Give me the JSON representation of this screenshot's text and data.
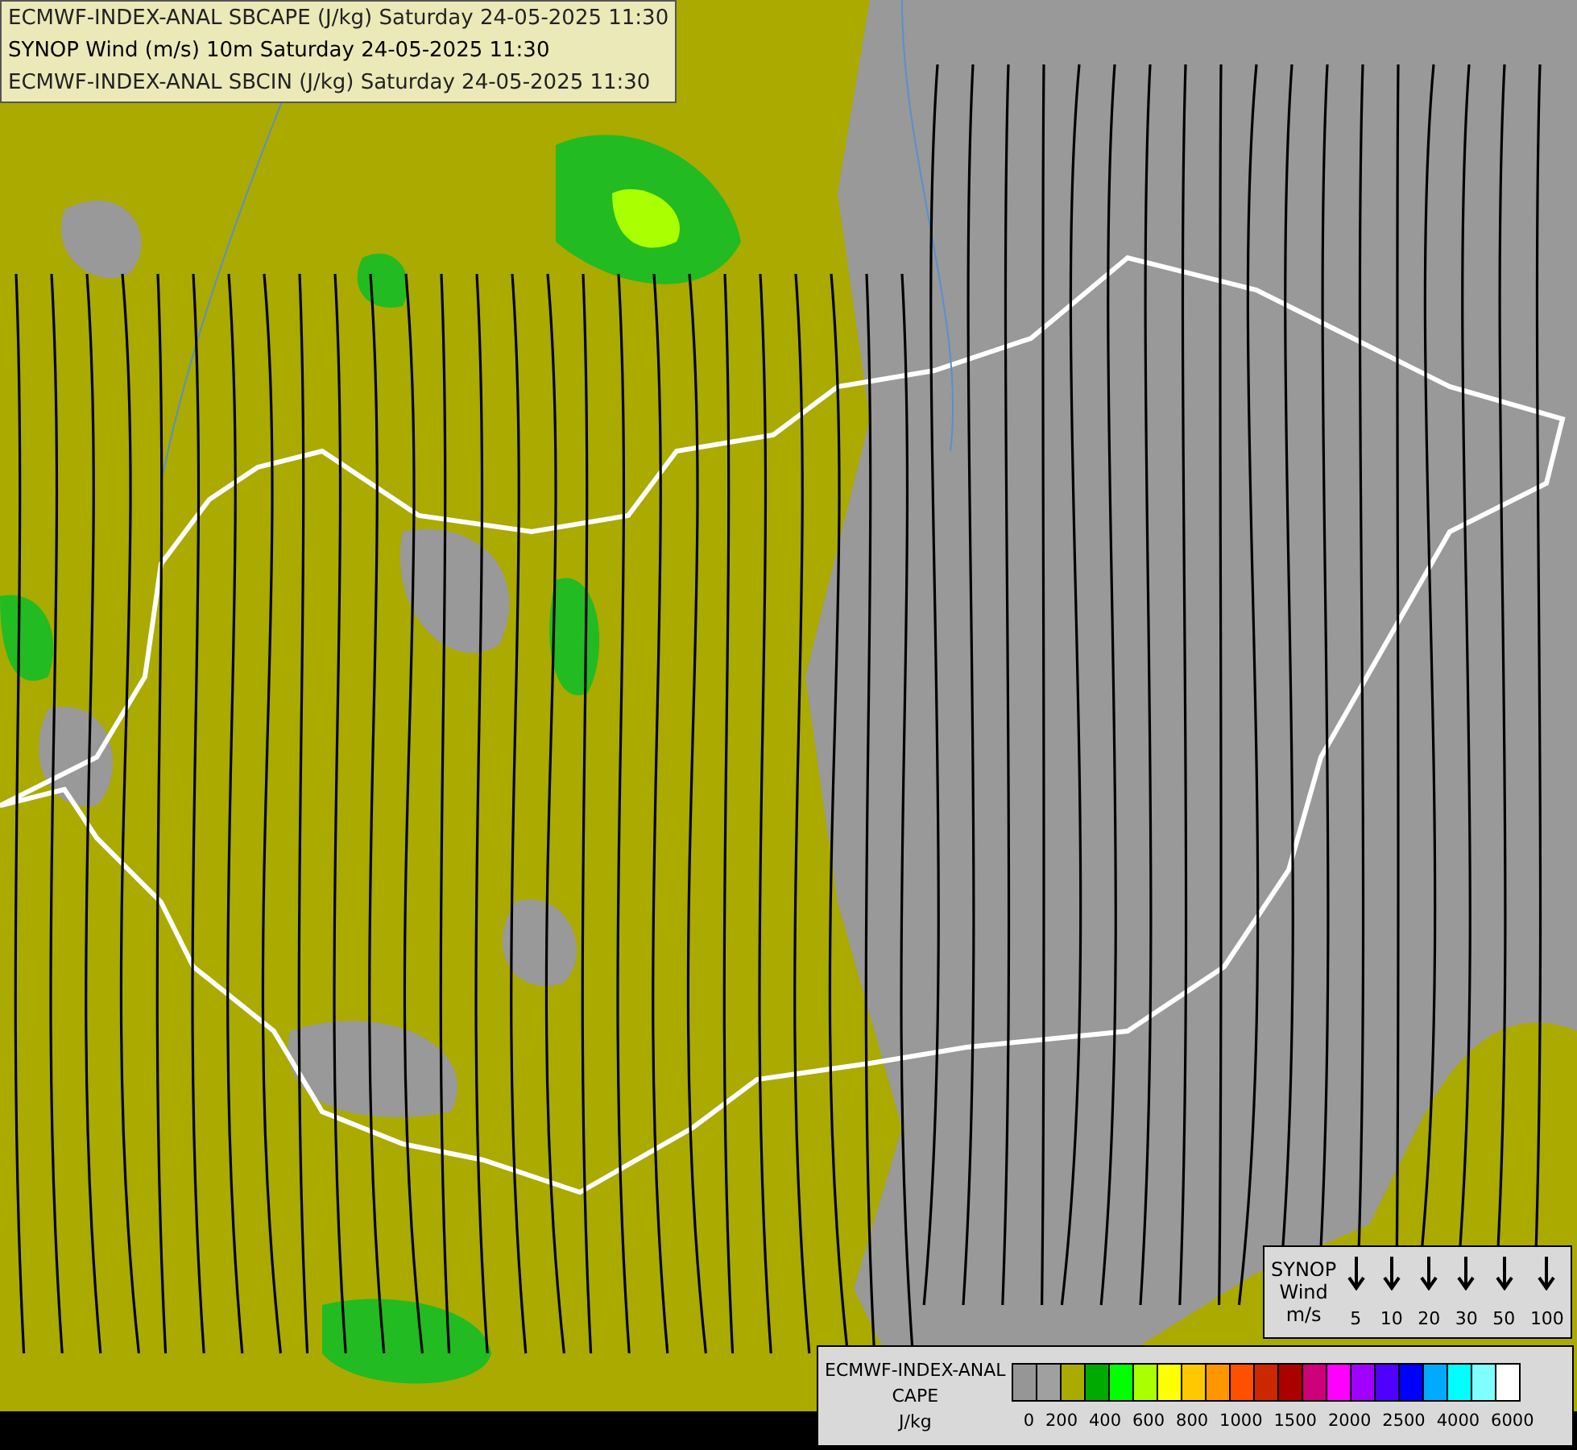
{
  "header": {
    "lines": [
      "ECMWF-INDEX-ANAL SBCAPE (J/kg) Saturday 24-05-2025 11:30",
      "SYNOP Wind (m/s) 10m Saturday 24-05-2025 11:30",
      "ECMWF-INDEX-ANAL SBCIN (J/kg) Saturday 24-05-2025 11:30"
    ]
  },
  "wind_legend": {
    "title_lines": [
      "SYNOP",
      "Wind",
      "m/s"
    ],
    "speeds": [
      "5",
      "10",
      "20",
      "30",
      "50",
      "100"
    ]
  },
  "cape_legend": {
    "title_lines": [
      "ECMWF-INDEX-ANAL",
      "CAPE",
      "J/kg"
    ],
    "swatches": [
      {
        "color": "#969696"
      },
      {
        "color": "#a0a0a0"
      },
      {
        "color": "#aaaa00"
      },
      {
        "color": "#00aa00"
      },
      {
        "color": "#00ff00"
      },
      {
        "color": "#aaff00"
      },
      {
        "color": "#ffff00"
      },
      {
        "color": "#ffc800"
      },
      {
        "color": "#ff9600"
      },
      {
        "color": "#ff5000"
      },
      {
        "color": "#cc2800"
      },
      {
        "color": "#aa0000"
      },
      {
        "color": "#cc0078"
      },
      {
        "color": "#ff00ff"
      },
      {
        "color": "#a000ff"
      },
      {
        "color": "#5000ff"
      },
      {
        "color": "#0000ff"
      },
      {
        "color": "#00aaff"
      },
      {
        "color": "#00ffff"
      },
      {
        "color": "#80ffff"
      },
      {
        "color": "#ffffff"
      }
    ],
    "labels": [
      "0",
      "200",
      "400",
      "600",
      "800",
      "1000",
      "1500",
      "2000",
      "2500",
      "4000",
      "6000"
    ]
  }
}
